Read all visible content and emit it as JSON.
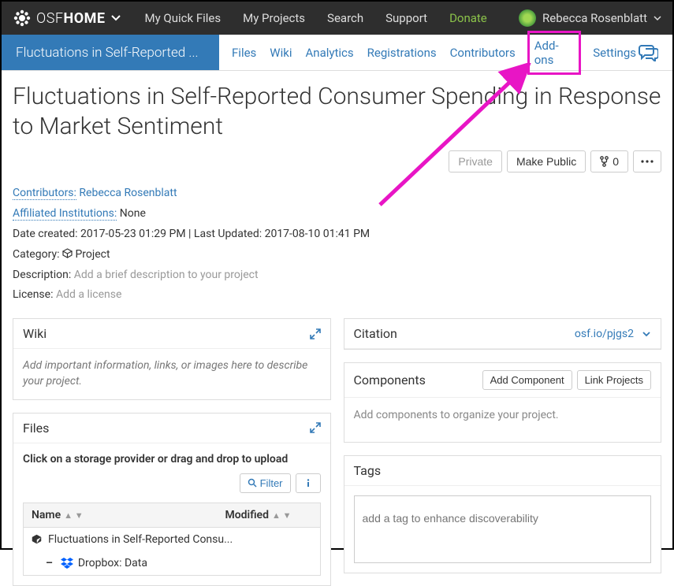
{
  "topnav": {
    "brand_prefix": "OSF",
    "brand_suffix": "HOME",
    "links": {
      "quick_files": "My Quick Files",
      "projects": "My Projects",
      "search": "Search",
      "support": "Support",
      "donate": "Donate"
    },
    "user_name": "Rebecca Rosenblatt"
  },
  "subnav": {
    "title": "Fluctuations in Self-Reported ...",
    "tabs": {
      "files": "Files",
      "wiki": "Wiki",
      "analytics": "Analytics",
      "registrations": "Registrations",
      "contributors": "Contributors",
      "addons": "Add-ons",
      "settings": "Settings"
    }
  },
  "project": {
    "title": "Fluctuations in Self-Reported Consumer Spending in Response to Market Sentiment",
    "actions": {
      "private": "Private",
      "make_public": "Make Public",
      "forks": "0"
    },
    "contributors_label": "Contributors:",
    "contributors_value": "Rebecca Rosenblatt",
    "affiliated_label": "Affiliated Institutions:",
    "affiliated_value": "None",
    "dates": "Date created: 2017-05-23 01:29 PM | Last Updated: 2017-08-10 01:41 PM",
    "category_label": "Category:",
    "category_value": "Project",
    "description_label": "Description:",
    "description_placeholder": "Add a brief description to your project",
    "license_label": "License:",
    "license_placeholder": "Add a license"
  },
  "wiki": {
    "title": "Wiki",
    "placeholder": "Add important information, links, or images here to describe your project."
  },
  "files": {
    "title": "Files",
    "instruction": "Click on a storage provider or drag and drop to upload",
    "filter_label": "Filter",
    "col_name": "Name",
    "col_modified": "Modified",
    "rows": [
      {
        "icon": "cube",
        "label": "Fluctuations in Self-Reported Consu..."
      },
      {
        "icon": "dropbox",
        "prefix": "–",
        "label": "Dropbox: Data"
      }
    ]
  },
  "citation": {
    "title": "Citation",
    "link": "osf.io/pjgs2"
  },
  "components": {
    "title": "Components",
    "add_btn": "Add Component",
    "link_btn": "Link Projects",
    "placeholder": "Add components to organize your project."
  },
  "tags": {
    "title": "Tags",
    "placeholder": "add a tag to enhance discoverability"
  }
}
